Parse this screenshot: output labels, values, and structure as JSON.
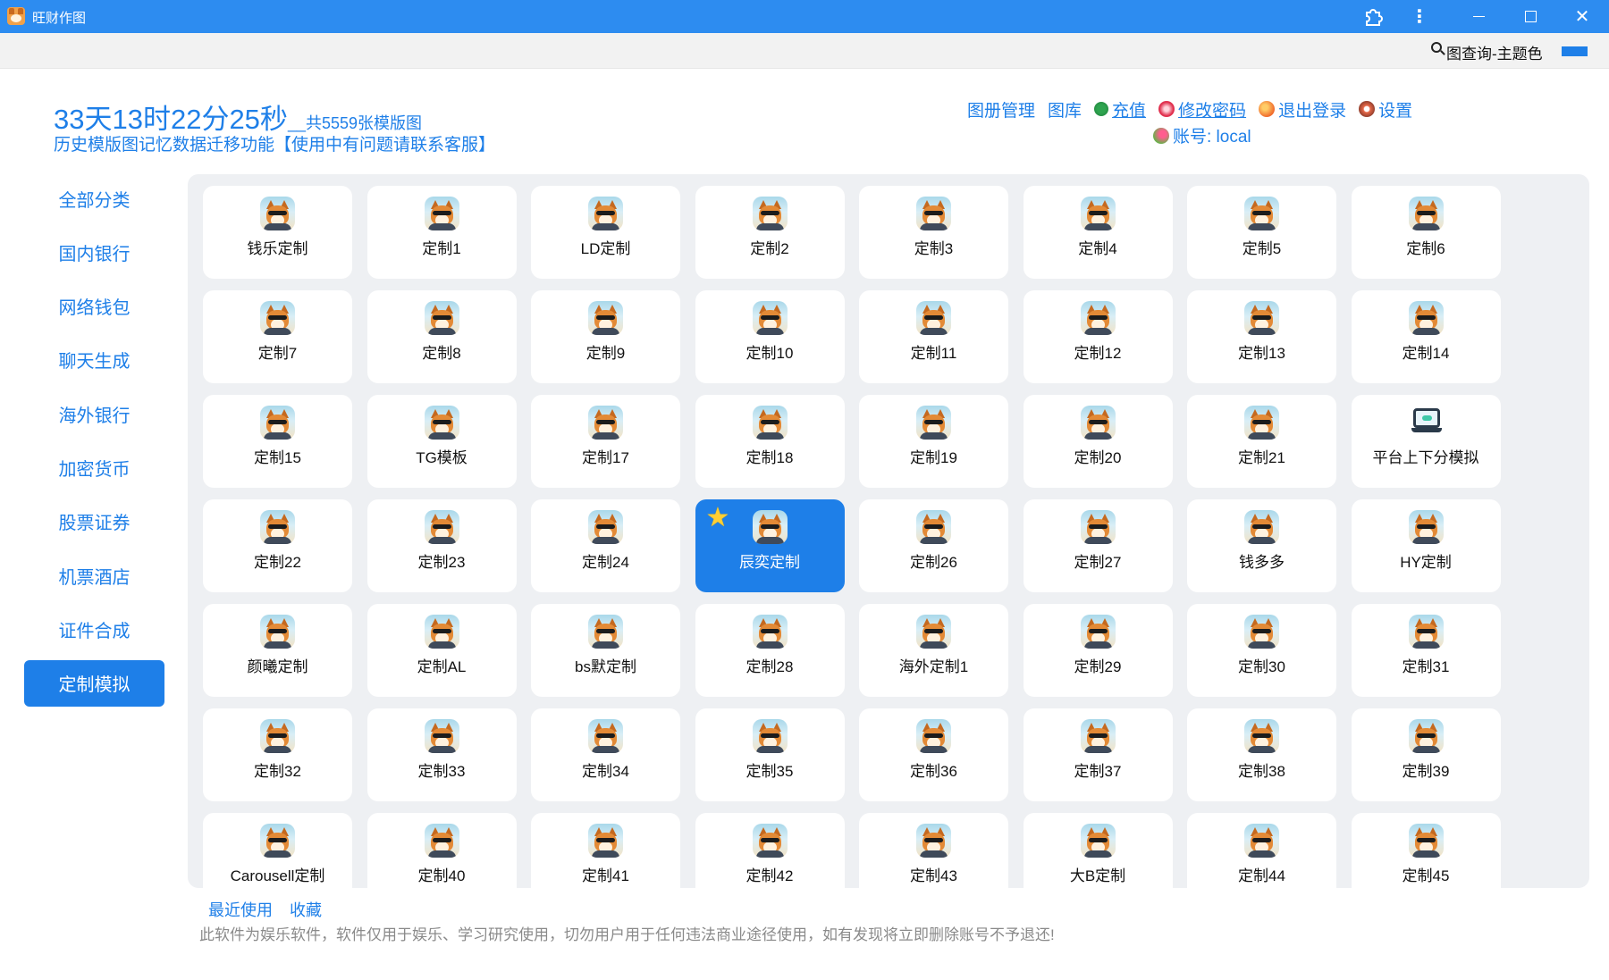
{
  "window": {
    "title": "旺财作图"
  },
  "toolbar": {
    "theme_label": "图查询-主题色",
    "theme_color": "#1e7fe8"
  },
  "header": {
    "countdown": "33天13时22分25秒",
    "template_count": "__共5559张模版图",
    "migration_note": "历史模版图记忆数据迁移功能【使用中有问题请联系客服】"
  },
  "topnav": {
    "album_manage": "图册管理",
    "gallery": "图库",
    "recharge": "充值",
    "change_password": "修改密码",
    "logout": "退出登录",
    "settings": "设置",
    "account": "账号: local"
  },
  "sidebar": {
    "items": [
      {
        "label": "全部分类"
      },
      {
        "label": "国内银行"
      },
      {
        "label": "网络钱包"
      },
      {
        "label": "聊天生成"
      },
      {
        "label": "海外银行"
      },
      {
        "label": "加密货币"
      },
      {
        "label": "股票证券"
      },
      {
        "label": "机票酒店"
      },
      {
        "label": "证件合成"
      },
      {
        "label": "定制模拟",
        "active": true
      }
    ]
  },
  "grid": {
    "cards": [
      {
        "label": "钱乐定制",
        "icon": "shiba-avatar-icon"
      },
      {
        "label": "定制1",
        "icon": "shiba-avatar-icon"
      },
      {
        "label": "LD定制",
        "icon": "shiba-avatar-icon"
      },
      {
        "label": "定制2",
        "icon": "shiba-avatar-icon"
      },
      {
        "label": "定制3",
        "icon": "shiba-avatar-icon"
      },
      {
        "label": "定制4",
        "icon": "shiba-avatar-icon"
      },
      {
        "label": "定制5",
        "icon": "shiba-avatar-icon"
      },
      {
        "label": "定制6",
        "icon": "shiba-avatar-icon"
      },
      {
        "label": "定制7",
        "icon": "shiba-avatar-icon"
      },
      {
        "label": "定制8",
        "icon": "shiba-avatar-icon"
      },
      {
        "label": "定制9",
        "icon": "shiba-avatar-icon"
      },
      {
        "label": "定制10",
        "icon": "shiba-avatar-icon"
      },
      {
        "label": "定制11",
        "icon": "shiba-avatar-icon"
      },
      {
        "label": "定制12",
        "icon": "shiba-avatar-icon"
      },
      {
        "label": "定制13",
        "icon": "shiba-avatar-icon"
      },
      {
        "label": "定制14",
        "icon": "shiba-avatar-icon"
      },
      {
        "label": "定制15",
        "icon": "shiba-avatar-icon"
      },
      {
        "label": "TG模板",
        "icon": "shiba-avatar-icon"
      },
      {
        "label": "定制17",
        "icon": "shiba-avatar-icon"
      },
      {
        "label": "定制18",
        "icon": "shiba-avatar-icon"
      },
      {
        "label": "定制19",
        "icon": "shiba-avatar-icon"
      },
      {
        "label": "定制20",
        "icon": "shiba-avatar-icon"
      },
      {
        "label": "定制21",
        "icon": "shiba-avatar-icon"
      },
      {
        "label": "平台上下分模拟",
        "icon": "laptop-icon"
      },
      {
        "label": "定制22",
        "icon": "shiba-avatar-icon"
      },
      {
        "label": "定制23",
        "icon": "shiba-avatar-icon"
      },
      {
        "label": "定制24",
        "icon": "shiba-avatar-icon"
      },
      {
        "label": "辰奕定制",
        "icon": "shiba-avatar-icon",
        "selected": true,
        "favorite": true
      },
      {
        "label": "定制26",
        "icon": "shiba-avatar-icon"
      },
      {
        "label": "定制27",
        "icon": "shiba-avatar-icon"
      },
      {
        "label": "钱多多",
        "icon": "shiba-avatar-icon"
      },
      {
        "label": "HY定制",
        "icon": "shiba-avatar-icon"
      },
      {
        "label": "颜曦定制",
        "icon": "shiba-avatar-icon"
      },
      {
        "label": "定制AL",
        "icon": "shiba-avatar-icon"
      },
      {
        "label": "bs默定制",
        "icon": "shiba-avatar-icon"
      },
      {
        "label": "定制28",
        "icon": "shiba-avatar-icon"
      },
      {
        "label": "海外定制1",
        "icon": "shiba-avatar-icon"
      },
      {
        "label": "定制29",
        "icon": "shiba-avatar-icon"
      },
      {
        "label": "定制30",
        "icon": "shiba-avatar-icon"
      },
      {
        "label": "定制31",
        "icon": "shiba-avatar-icon"
      },
      {
        "label": "定制32",
        "icon": "shiba-avatar-icon"
      },
      {
        "label": "定制33",
        "icon": "shiba-avatar-icon"
      },
      {
        "label": "定制34",
        "icon": "shiba-avatar-icon"
      },
      {
        "label": "定制35",
        "icon": "shiba-avatar-icon"
      },
      {
        "label": "定制36",
        "icon": "shiba-avatar-icon"
      },
      {
        "label": "定制37",
        "icon": "shiba-avatar-icon"
      },
      {
        "label": "定制38",
        "icon": "shiba-avatar-icon"
      },
      {
        "label": "定制39",
        "icon": "shiba-avatar-icon"
      },
      {
        "label": "Carousell定制",
        "icon": "shiba-avatar-icon"
      },
      {
        "label": "定制40",
        "icon": "shiba-avatar-icon"
      },
      {
        "label": "定制41",
        "icon": "shiba-avatar-icon"
      },
      {
        "label": "定制42",
        "icon": "shiba-avatar-icon"
      },
      {
        "label": "定制43",
        "icon": "shiba-avatar-icon"
      },
      {
        "label": "大B定制",
        "icon": "shiba-avatar-icon"
      },
      {
        "label": "定制44",
        "icon": "shiba-avatar-icon"
      },
      {
        "label": "定制45",
        "icon": "shiba-avatar-icon"
      }
    ]
  },
  "footer": {
    "recent": "最近使用",
    "favorites": "收藏",
    "disclaimer": "此软件为娱乐软件，软件仅用于娱乐、学习研究使用，切勿用户用于任何违法商业途径使用，如有发现将立即删除账号不予退还!"
  }
}
